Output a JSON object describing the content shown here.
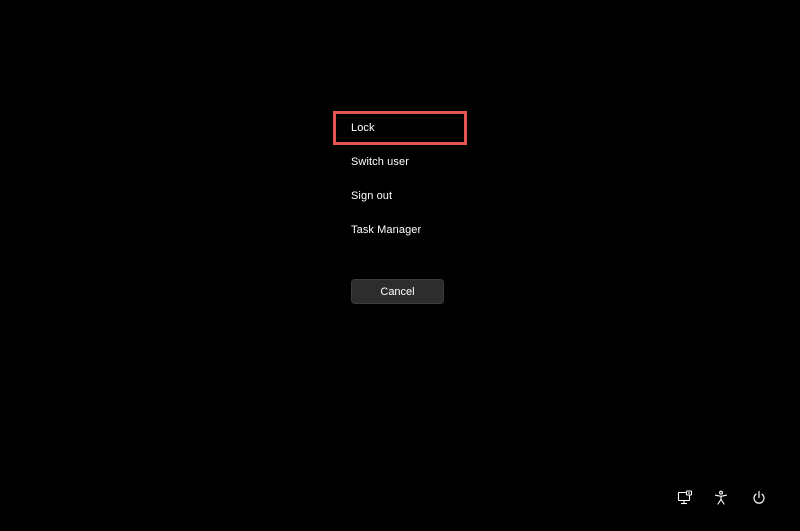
{
  "menu": {
    "items": [
      {
        "label": "Lock",
        "highlighted": true
      },
      {
        "label": "Switch user",
        "highlighted": false
      },
      {
        "label": "Sign out",
        "highlighted": false
      },
      {
        "label": "Task Manager",
        "highlighted": false
      }
    ]
  },
  "cancel_label": "Cancel",
  "tray": {
    "icons": [
      "network-icon",
      "accessibility-icon",
      "power-icon"
    ]
  },
  "colors": {
    "background": "#000000",
    "text": "#ffffff",
    "highlight_border": "#e25653",
    "button_bg": "#2d2d2d"
  }
}
